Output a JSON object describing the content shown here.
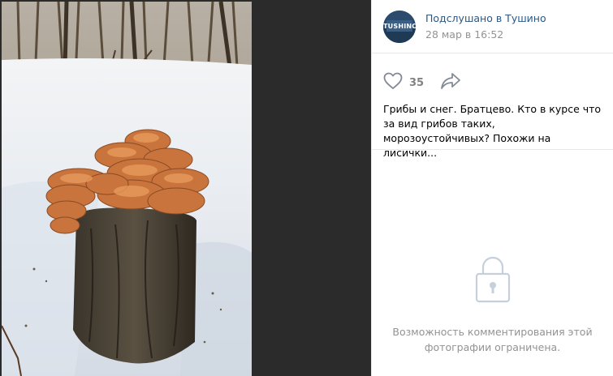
{
  "post": {
    "group_name": "Подслушано в Тушино",
    "date": "28 мар в 16:52",
    "avatar_text": "TUSHINO",
    "likes": "35",
    "text": "Грибы и снег. Братцево. Кто в курсе что за вид грибов таких, морозоустойчивых? Похожи на лисички..."
  },
  "comments": {
    "restricted_message": "Возможность комментирования этой фотографии ограничена."
  },
  "icons": {
    "like": "heart-icon",
    "share": "share-arrow-icon",
    "lock": "lock-icon"
  },
  "colors": {
    "link": "#2a5885",
    "muted": "#939393",
    "like_gray": "#828282",
    "lock_gray": "#c5d0db"
  }
}
